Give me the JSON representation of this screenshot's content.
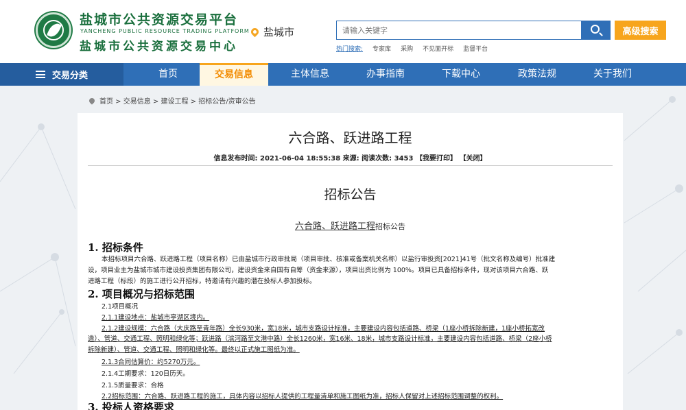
{
  "header": {
    "title_main": "盐城市公共资源交易平台",
    "title_en": "YANCHENG PUBLIC RESOURCE TRADING PLATFORM",
    "title_sub": "盐城市公共资源交易中心",
    "city": "盐城市",
    "search_placeholder": "请输入关键字",
    "advanced_search": "高级搜索",
    "hot_label": "热门搜索:",
    "hot_items": [
      "专家库",
      "采购",
      "不见面开标",
      "监督平台"
    ]
  },
  "nav": {
    "category": "交易分类",
    "items": [
      "首页",
      "交易信息",
      "主体信息",
      "办事指南",
      "下载中心",
      "政策法规",
      "关于我们"
    ],
    "active_index": 1
  },
  "breadcrumb": "首页 > 交易信息 > 建设工程 > 招标公告/资审公告",
  "article": {
    "title": "六合路、跃进路工程",
    "meta": "信息发布时间: 2021-06-04 18:55:38  来源:      阅读次数: 3453 【我要打印】 【关闭】",
    "notice_title": "招标公告",
    "notice_sub_project": "六合路、跃进路工程",
    "notice_sub_suffix": "招标公告",
    "sec1": "1.  招标条件",
    "sec1_p1": "本招标项目六合路、跃进路工程（项目名称）已由盐城市行政审批局（项目审批、核准或备案机关名称）以盐行审投资[2021]41号（批文名称及编号）批准建",
    "sec1_p2": "设，项目业主为盐城市城市建设投资集团有限公司，建设资金来自国有自筹（资金来源），项目出资比例为  100%。项目已具备招标条件，现对该项目六合路、跃",
    "sec1_p3": "进路工程（标段）的施工进行公开招标，特邀请有兴趣的潜在投标人参加投标。",
    "sec2": "2.  项目概况与招标范围",
    "l21": "2.1项目概况",
    "l211": "2.1.1建设地点：盐城市亭湖区境内。",
    "l212a": "2.1.2建设规模：六合路（大庆路至青年路）全长930米，宽18米，城市支路设计标准，主要建设内容包括道路、桥梁（1座小桥拆除新建，1座小桥拓宽改",
    "l212b": "造）、管道、交通工程、照明和绿化等；跃进路（滨河路至文港中路）全长1260米，宽16米、18米，城市支路设计标准，主要建设内容包括道路、桥梁（2座小桥",
    "l212c": "拆除新建）、管道、交通工程、照明和绿化等。最终以正式施工图纸为准。",
    "l213": "2.1.3合同估算价：约5270万元。",
    "l214": "2.1.4工期要求：120日历天。",
    "l215": "2.1.5质量要求：合格",
    "l22": "2.2招标范围：六合路、跃进路工程的施工，具体内容以招标人提供的工程量清单和施工图纸为准，招标人保留对上述招标范围调整的权利。",
    "sec3": "3.  投标人资格要求"
  }
}
